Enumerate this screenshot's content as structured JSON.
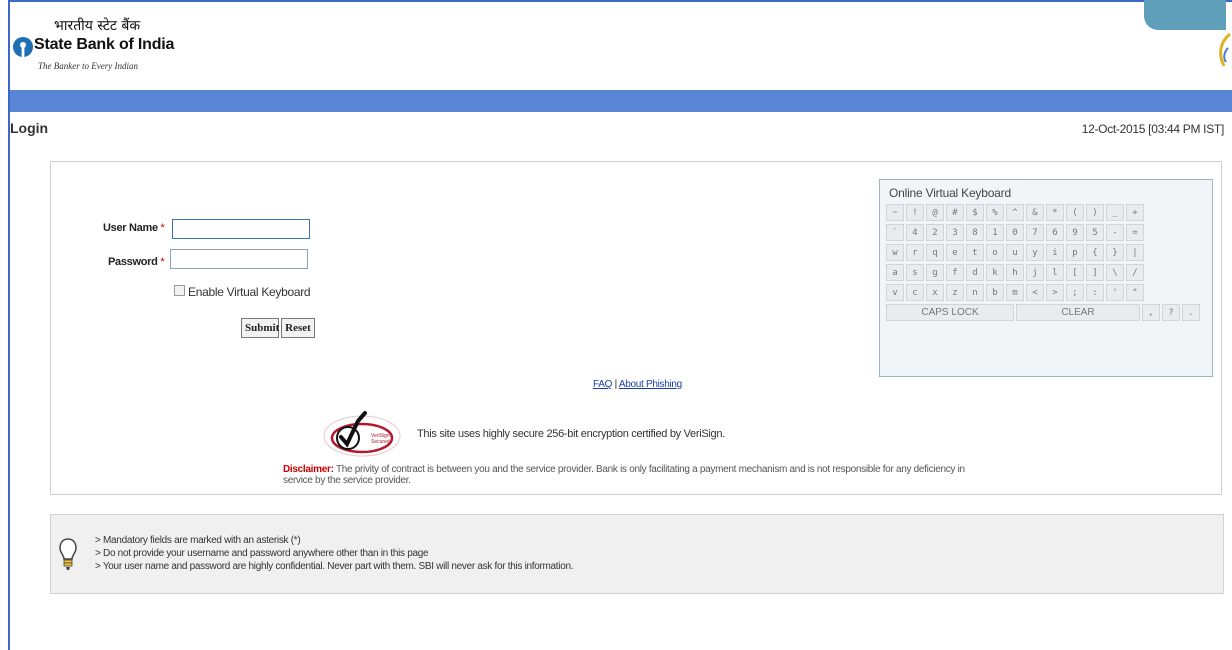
{
  "header": {
    "hindi_name": "भारतीय स्टेट बैंक",
    "bank_name": "State Bank of India",
    "tagline": "The Banker to Every Indian"
  },
  "page": {
    "title": "Login",
    "datetime": "12-Oct-2015 [03:44 PM IST]"
  },
  "login_form": {
    "username_label": "User Name",
    "password_label": "Password",
    "required_mark": "*",
    "username_value": "",
    "password_value": "",
    "enable_vk_label": "Enable Virtual Keyboard",
    "submit_label": "Submit",
    "reset_label": "Reset"
  },
  "links": {
    "faq": "FAQ",
    "separator": "|",
    "phishing": "About Phishing"
  },
  "security": {
    "badge_text_1": "VeriSign",
    "badge_text_2": "Secured",
    "message": "This site uses highly secure 256-bit encryption certified by VeriSign."
  },
  "disclaimer": {
    "label": "Disclaimer:",
    "text": "The privity of contract is between you and the service provider. Bank is only facilitating a payment mechanism and is not responsible for any deficiency in service by the service provider."
  },
  "virtual_keyboard": {
    "title": "Online Virtual Keyboard",
    "rows": [
      [
        "~",
        "!",
        "@",
        "#",
        "$",
        "%",
        "^",
        "&",
        "*",
        "(",
        ")",
        "_",
        "+"
      ],
      [
        "`",
        "4",
        "2",
        "3",
        "8",
        "1",
        "0",
        "7",
        "6",
        "9",
        "5",
        "-",
        "="
      ],
      [
        "w",
        "r",
        "q",
        "e",
        "t",
        "o",
        "u",
        "y",
        "i",
        "p",
        "{",
        "}",
        "|"
      ],
      [
        "a",
        "s",
        "g",
        "f",
        "d",
        "k",
        "h",
        "j",
        "l",
        "[",
        "]",
        "\\",
        "/"
      ],
      [
        "v",
        "c",
        "x",
        "z",
        "n",
        "b",
        "m",
        "<",
        ">",
        ";",
        ":",
        "'",
        "\""
      ]
    ],
    "caps_lock": "CAPS LOCK",
    "clear": "CLEAR",
    "bottom_keys": [
      ",",
      "?",
      "."
    ]
  },
  "info": {
    "items": [
      "> Mandatory fields are marked with an asterisk (*)",
      "> Do not provide your username and password anywhere other than in this page",
      "> Your user name and password are highly confidential. Never part with them. SBI will never ask for this information."
    ]
  },
  "colors": {
    "frame_blue": "#3c69c8",
    "bar_blue": "#5a85d6",
    "disclaimer_red": "#cc0000",
    "link_blue": "#1a3fa8"
  },
  "icons": {
    "logo": "sbi-keyhole-logo-icon",
    "verisign": "verisign-checkmark-icon",
    "bulb": "lightbulb-icon"
  }
}
